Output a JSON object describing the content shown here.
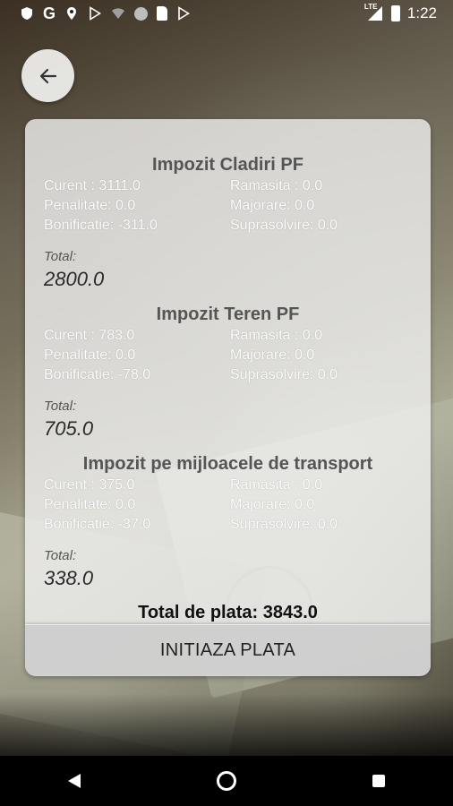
{
  "status_bar": {
    "time": "1:22",
    "network": "LTE",
    "left_icons": [
      "shield-icon",
      "google-icon",
      "location-icon",
      "play-store-icon",
      "wifi-icon",
      "circle-icon",
      "sd-card-icon",
      "play-store-icon"
    ],
    "google_letter": "G"
  },
  "back_button": {
    "icon": "arrow-left-icon"
  },
  "sections": [
    {
      "title": "Impozit Cladiri PF",
      "curent": "Curent :  3111.0",
      "ramasita": "Ramasita :  0.0",
      "penalitate": "Penalitate:  0.0",
      "majorare": "Majorare:  0.0",
      "bonificatie": "Bonificatie: -311.0",
      "suprasolvire": "Suprasolvire:  0.0",
      "total_label": "Total:",
      "total_value": "2800.0"
    },
    {
      "title": "Impozit Teren PF",
      "curent": "Curent :  783.0",
      "ramasita": "Ramasita :  0.0",
      "penalitate": "Penalitate:  0.0",
      "majorare": "Majorare:  0.0",
      "bonificatie": "Bonificatie: -78.0",
      "suprasolvire": "Suprasolvire:  0.0",
      "total_label": "Total:",
      "total_value": "705.0"
    },
    {
      "title": "Impozit pe mijloacele de transport",
      "curent": "Curent :  375.0",
      "ramasita": "Ramasita :  0.0",
      "penalitate": "Penalitate:  0.0",
      "majorare": "Majorare:  0.0",
      "bonificatie": "Bonificatie: -37.0",
      "suprasolvire": "Suprasolvire:  0.0",
      "total_label": "Total:",
      "total_value": "338.0"
    }
  ],
  "grand_total": "Total de plata: 3843.0",
  "pay_button_label": "INITIAZA PLATA",
  "nav_bar": {
    "icons": [
      "nav-back-icon",
      "nav-home-icon",
      "nav-recents-icon"
    ]
  }
}
